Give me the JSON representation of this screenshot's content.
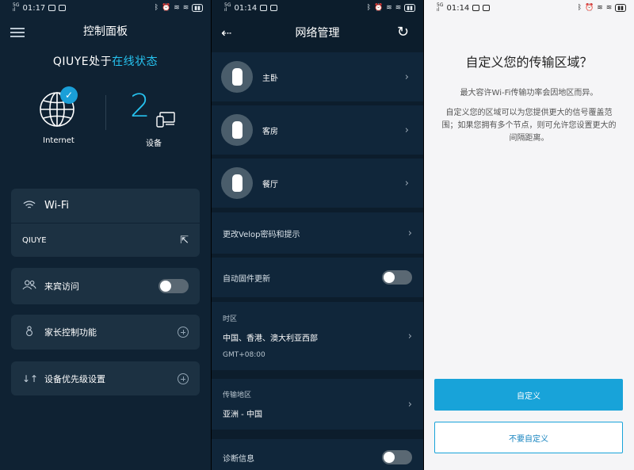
{
  "status_bars": [
    {
      "time": "01:17"
    },
    {
      "time": "01:14"
    },
    {
      "time": "01:14"
    }
  ],
  "dashboard": {
    "title": "控制面板",
    "network_name": "QIUYE处于",
    "status_text": "在线状态",
    "internet_label": "Internet",
    "device_count": "2",
    "devices_label": "设备",
    "wifi_label": "Wi-Fi",
    "ssid": "QIUYE",
    "guest_access": "来宾访问",
    "parental_controls": "家长控制功能",
    "device_priority": "设备优先级设置",
    "accent_color": "#26c2ef"
  },
  "network_admin": {
    "title": "网络管理",
    "nodes": [
      {
        "name": "主卧"
      },
      {
        "name": "客房"
      },
      {
        "name": "餐厅"
      }
    ],
    "change_password": "更改Velop密码和提示",
    "auto_firmware": "自动固件更新",
    "timezone_label": "时区",
    "timezone_value": "中国、香港、澳大利亚西部",
    "timezone_offset": "GMT+08:00",
    "region_label": "传输地区",
    "region_value": "亚洲 - 中国",
    "diagnostics": "诊断信息"
  },
  "customize_region": {
    "title": "自定义您的传输区域？",
    "para1": "最大容许Wi-Fi传输功率会因地区而异。",
    "para2": "自定义您的区域可以为您提供更大的信号覆盖范围；如果您拥有多个节点，则可允许您设置更大的间隔距离。",
    "primary_button": "自定义",
    "secondary_button": "不要自定义",
    "accent_color": "#18a3d9"
  }
}
